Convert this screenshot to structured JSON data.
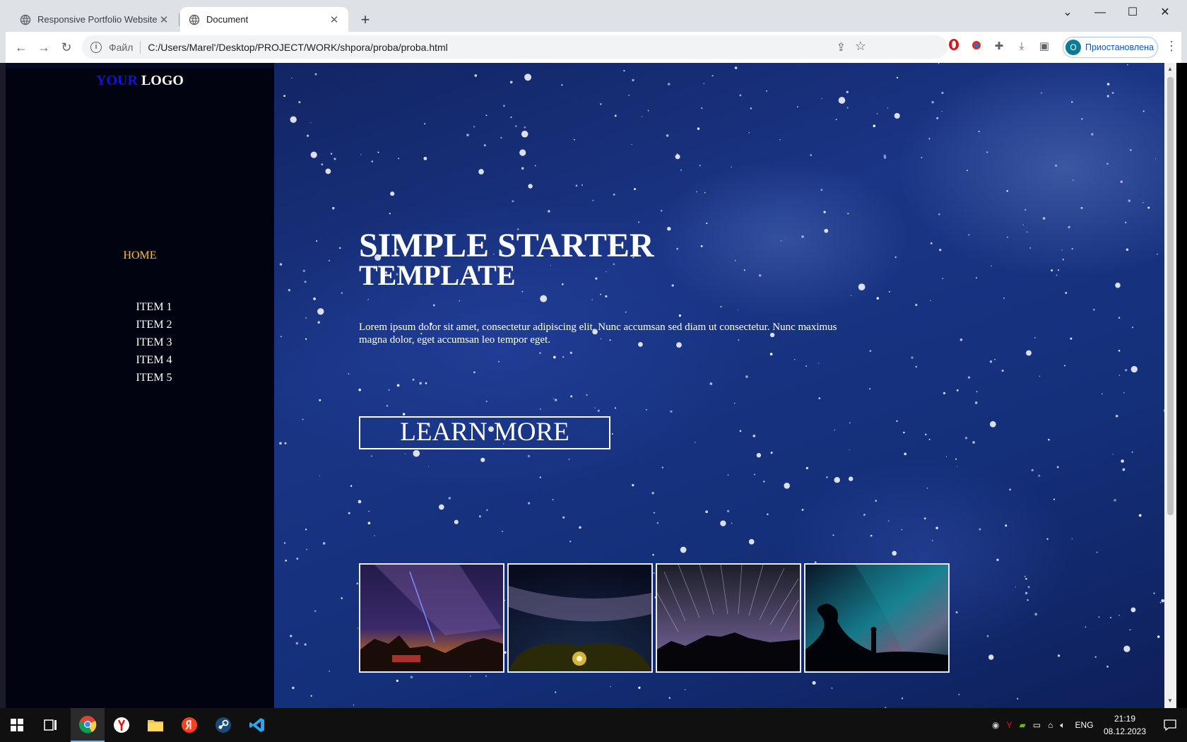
{
  "browser": {
    "tabs": [
      {
        "title": "Responsive Portfolio Website",
        "active": false
      },
      {
        "title": "Document",
        "active": true
      }
    ],
    "address": {
      "scheme_label": "Файл",
      "url": "C:/Users/Marel'/Desktop/PROJECT/WORK/shpora/proba/proba.html"
    },
    "profile": {
      "initial": "O",
      "label": "Приостановлена"
    }
  },
  "page": {
    "logo": {
      "accent": "YOUR",
      "rest": "LOGO"
    },
    "nav": {
      "home": "HOME",
      "items": [
        "ITEM 1",
        "ITEM 2",
        "ITEM 3",
        "ITEM 4",
        "ITEM 5"
      ]
    },
    "hero": {
      "title_line1": "SIMPLE STARTER",
      "title_line2": "TEMPLATE",
      "text": "Lorem ipsum dolor sit amet, consectetur adipiscing elit. Nunc accumsan sed diam ut consectetur. Nunc maximus magna dolor, eget accumsan leo tempor eget.",
      "button": "LEARN MORE"
    },
    "gallery": [
      "milky-way-laser",
      "milky-way-fisheye",
      "star-trails",
      "aurora-silhouette"
    ]
  },
  "taskbar": {
    "language": "ENG",
    "time": "21:19",
    "date": "08.12.2023"
  },
  "colors": {
    "sidebar_bg": "#020310",
    "logo_accent": "#1212d8",
    "nav_active": "#ffc21a",
    "hero_bg": "#1a3585"
  }
}
